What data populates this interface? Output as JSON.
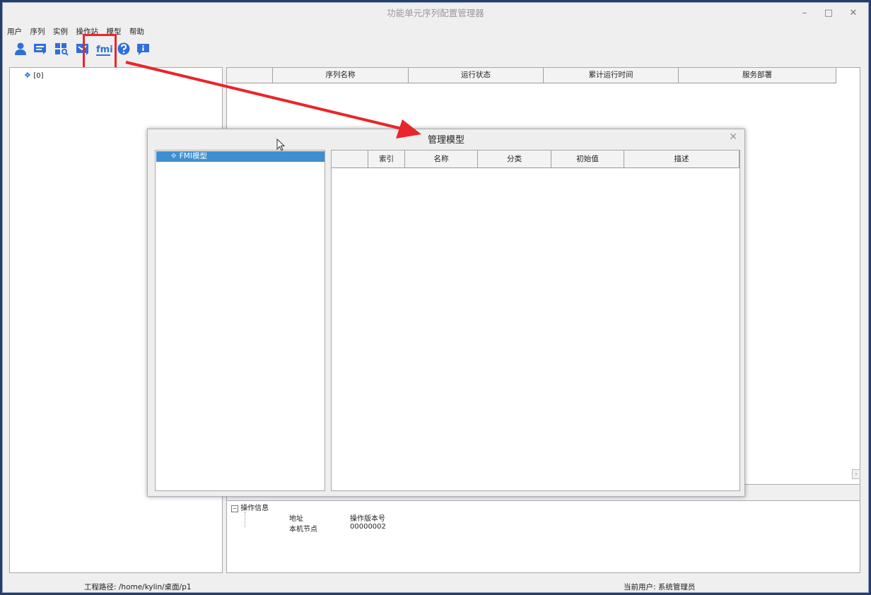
{
  "window": {
    "title": "功能单元序列配置管理器"
  },
  "menu": [
    "用户",
    "序列",
    "实例",
    "操作站",
    "模型",
    "帮助"
  ],
  "toolbar": {
    "icons": [
      "user-icon",
      "sequence-icon",
      "instance-icon",
      "station-icon",
      "fmi-icon",
      "help-icon",
      "info-icon"
    ],
    "fmi_glyph": "fmi"
  },
  "tree": {
    "root": "[0]"
  },
  "sequence_table": {
    "columns": [
      "",
      "序列名称",
      "运行状态",
      "累计运行时间",
      "服务部署"
    ]
  },
  "info_panel": {
    "section": "操作信息",
    "rows": [
      {
        "key": "地址",
        "value": "操作版本号"
      },
      {
        "key": "本机节点",
        "value": "00000002"
      }
    ]
  },
  "dialog": {
    "title": "管理模型",
    "tree_item": "FMI模型",
    "columns": [
      "",
      "索引",
      "名称",
      "分类",
      "初始值",
      "描述"
    ]
  },
  "status": {
    "project_path": "工程路径: /home/kylin/桌面/p1",
    "current_user": "当前用户: 系统管理员"
  },
  "colors": {
    "accent": "#2f6fd8",
    "annotation": "#e8262b",
    "selection": "#3f8ed1"
  }
}
